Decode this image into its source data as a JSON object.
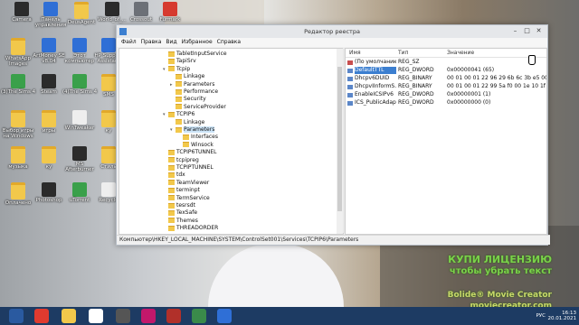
{
  "desktop": {
    "icons": [
      {
        "label": "Camera",
        "icon": "camera-icon",
        "kind": "dark"
      },
      {
        "label": "Панель управления",
        "icon": "control-panel-icon",
        "kind": "blue"
      },
      {
        "label": "DeusAgent",
        "icon": "folder-icon",
        "kind": "folder"
      },
      {
        "label": "World_of_...",
        "icon": "world-of-tanks-icon",
        "kind": "dark"
      },
      {
        "label": "Crossout",
        "icon": "crossout-icon",
        "kind": "gray"
      },
      {
        "label": "Furmark",
        "icon": "furmark-icon",
        "kind": "red"
      },
      {
        "label": "WhatsApp Images",
        "icon": "folder-icon",
        "kind": "folder"
      },
      {
        "label": "ArtMoney SE v8.04",
        "icon": "artmoney-icon",
        "kind": "blue"
      },
      {
        "label": "Этот компьютер",
        "icon": "this-pc-icon",
        "kind": "blue"
      },
      {
        "label": "HP Support Assistant",
        "icon": "hp-support-icon",
        "kind": "blue"
      },
      {
        "label": "(3)The Sims 4",
        "icon": "sims4-icon",
        "kind": "green"
      },
      {
        "label": "Steam",
        "icon": "steam-icon",
        "kind": "dark"
      },
      {
        "label": "(4)The Sims 4",
        "icon": "sims4-icon",
        "kind": "green"
      },
      {
        "label": "SMS",
        "icon": "folder-icon",
        "kind": "folder"
      },
      {
        "label": "Выбор игры на Windows",
        "icon": "folder-icon",
        "kind": "folder"
      },
      {
        "label": "игры",
        "icon": "folder-icon",
        "kind": "folder"
      },
      {
        "label": "WinTweaker",
        "icon": "wintweaker-icon",
        "kind": "white"
      },
      {
        "label": "ку",
        "icon": "folder-icon",
        "kind": "folder"
      },
      {
        "label": "музыка",
        "icon": "folder-icon",
        "kind": "folder"
      },
      {
        "label": "ку",
        "icon": "folder-icon",
        "kind": "folder"
      },
      {
        "label": "MS Afterburner",
        "icon": "afterburner-icon",
        "kind": "dark"
      },
      {
        "label": "Стиль",
        "icon": "folder-icon",
        "kind": "folder"
      },
      {
        "label": "Оплачено",
        "icon": "folder-icon",
        "kind": "folder"
      },
      {
        "label": "Photoshop",
        "icon": "photoshop-icon",
        "kind": "dark"
      },
      {
        "label": "uTorrent",
        "icon": "utorrent-icon",
        "kind": "green"
      },
      {
        "label": "Recycle",
        "icon": "recycle-bin-icon",
        "kind": "white"
      }
    ]
  },
  "regedit": {
    "title": "Редактор реестра",
    "menu": [
      "Файл",
      "Правка",
      "Вид",
      "Избранное",
      "Справка"
    ],
    "tree": [
      {
        "label": "TabletInputService",
        "depth": 0,
        "expander": ""
      },
      {
        "label": "TapiSrv",
        "depth": 0,
        "expander": ""
      },
      {
        "label": "Tcpip",
        "depth": 0,
        "expander": "▾"
      },
      {
        "label": "Linkage",
        "depth": 1,
        "expander": ""
      },
      {
        "label": "Parameters",
        "depth": 1,
        "expander": "▸"
      },
      {
        "label": "Performance",
        "depth": 1,
        "expander": ""
      },
      {
        "label": "Security",
        "depth": 1,
        "expander": ""
      },
      {
        "label": "ServiceProvider",
        "depth": 1,
        "expander": ""
      },
      {
        "label": "TCPIP6",
        "depth": 0,
        "expander": "▾"
      },
      {
        "label": "Linkage",
        "depth": 1,
        "expander": ""
      },
      {
        "label": "Parameters",
        "depth": 1,
        "expander": "▾",
        "selected": true
      },
      {
        "label": "Interfaces",
        "depth": 2,
        "expander": ""
      },
      {
        "label": "Winsock",
        "depth": 2,
        "expander": ""
      },
      {
        "label": "TCPIP6TUNNEL",
        "depth": 0,
        "expander": ""
      },
      {
        "label": "tcpipreg",
        "depth": 0,
        "expander": ""
      },
      {
        "label": "TCPIPTUNNEL",
        "depth": 0,
        "expander": ""
      },
      {
        "label": "tdx",
        "depth": 0,
        "expander": ""
      },
      {
        "label": "TeamViewer",
        "depth": 0,
        "expander": ""
      },
      {
        "label": "terminpt",
        "depth": 0,
        "expander": ""
      },
      {
        "label": "TermService",
        "depth": 0,
        "expander": ""
      },
      {
        "label": "tesrsdt",
        "depth": 0,
        "expander": ""
      },
      {
        "label": "TexSafe",
        "depth": 0,
        "expander": ""
      },
      {
        "label": "Themes",
        "depth": 0,
        "expander": ""
      },
      {
        "label": "THREADORDER",
        "depth": 0,
        "expander": ""
      }
    ],
    "columns": {
      "name": "Имя",
      "type": "Тип",
      "value": "Значение"
    },
    "values": [
      {
        "name": "(По умолчанию)",
        "type": "REG_SZ",
        "value": "",
        "icon": "ab"
      },
      {
        "name": "DefaultTTL",
        "type": "REG_DWORD",
        "value": "0x00000041 (65)",
        "icon": "bin",
        "selected": true
      },
      {
        "name": "Dhcpv6DUID",
        "type": "REG_BINARY",
        "value": "00 01 00 01 22 96 29 6b 6c 3b e5 00 c7 ec",
        "icon": "bin"
      },
      {
        "name": "DhcpvIInformS...",
        "type": "REG_BINARY",
        "value": "00 01 00 01 22 99 5a f0 00 1e 10 1f 00 00",
        "icon": "bin"
      },
      {
        "name": "EnableICSIPv6",
        "type": "REG_DWORD",
        "value": "0x00000001 (1)",
        "icon": "bin"
      },
      {
        "name": "ICS_PublicAdapt...",
        "type": "REG_DWORD",
        "value": "0x00000000 (0)",
        "icon": "bin"
      }
    ],
    "status_path": "Компьютер\\HKEY_LOCAL_MACHINE\\SYSTEM\\ControlSet001\\Services\\TCPIP6\\Parameters"
  },
  "watermark": {
    "line1": "КУПИ ЛИЦЕНЗИЮ",
    "line2": "чтобы убрать текст",
    "line3": "Bolide® Movie Creator",
    "line4": "moviecreator.com"
  },
  "taskbar": {
    "buttons": [
      {
        "icon": "windows-start-icon",
        "color": "#2a5aa0"
      },
      {
        "icon": "yandex-icon",
        "color": "#e03a2f"
      },
      {
        "icon": "file-explorer-icon",
        "color": "#f2c84b"
      },
      {
        "icon": "yandex-browser-icon",
        "color": "#ffffff"
      },
      {
        "icon": "world-of-tanks-icon",
        "color": "#555555"
      },
      {
        "icon": "media-icon",
        "color": "#c2186b"
      },
      {
        "icon": "aida-icon",
        "color": "#b1302a"
      },
      {
        "icon": "game-icon",
        "color": "#3a8a4a"
      },
      {
        "icon": "movie-creator-icon",
        "color": "#2f6fd6"
      }
    ],
    "lang": "РУС",
    "time": "16:13",
    "date": "20.01.2021"
  }
}
